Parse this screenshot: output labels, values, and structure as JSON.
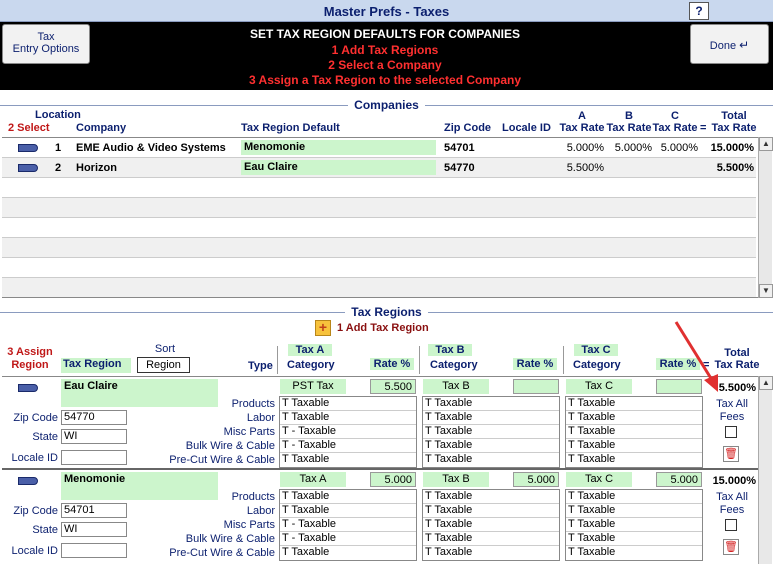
{
  "window": {
    "title": "Master Prefs - Taxes",
    "help": "?"
  },
  "toolbar": {
    "tax_entry_line1": "Tax",
    "tax_entry_line2": "Entry Options",
    "done_label": "Done",
    "heading": "SET TAX REGION DEFAULTS FOR COMPANIES",
    "step1": "1 Add Tax Regions",
    "step2": "2 Select a Company",
    "step3": "3 Assign a Tax Region to the selected Company"
  },
  "companies": {
    "section_title": "Companies",
    "headers": {
      "location": "Location",
      "select": "2 Select",
      "company": "Company",
      "tax_region_default": "Tax Region Default",
      "zip": "Zip Code",
      "locale": "Locale ID",
      "a_top": "A",
      "a_bottom": "Tax Rate",
      "b_top": "B",
      "b_bottom": "Tax Rate",
      "c_top": "C",
      "c_bottom": "Tax Rate",
      "eq": "=",
      "total_top": "Total",
      "total_bottom": "Tax Rate"
    },
    "rows": [
      {
        "num": "1",
        "company": "EME Audio & Video Systems",
        "region": "Menomonie",
        "zip": "54701",
        "locale": "",
        "a": "5.000%",
        "b": "5.000%",
        "c": "5.000%",
        "total": "15.000%"
      },
      {
        "num": "2",
        "company": "Horizon",
        "region": "Eau Claire",
        "zip": "54770",
        "locale": "",
        "a": "5.500%",
        "b": "",
        "c": "",
        "total": "5.500%"
      }
    ]
  },
  "regions": {
    "section_title": "Tax Regions",
    "add_label": "1 Add Tax Region",
    "headers": {
      "assign_top": "3 Assign",
      "assign_bottom": "Region",
      "tax_region": "Tax Region",
      "sort": "Sort",
      "sort_button": "Region",
      "type": "Type",
      "taxa_top": "Tax A",
      "taxa_bottom": "Category",
      "taxb_top": "Tax B",
      "taxb_bottom": "Category",
      "taxc_top": "Tax C",
      "taxc_bottom": "Category",
      "rate": "Rate %",
      "eq": "=",
      "total_top": "Total",
      "total_bottom": "Tax Rate"
    },
    "field_labels": {
      "zip": "Zip Code",
      "state": "State",
      "locale": "Locale ID",
      "tax_all_1": "Tax All",
      "tax_all_2": "Fees"
    },
    "types": [
      "Products",
      "Labor",
      "Misc Parts",
      "Bulk Wire & Cable",
      "Pre-Cut Wire & Cable"
    ],
    "items": [
      {
        "name": "Eau Claire",
        "zip": "54770",
        "state": "WI",
        "locale": "",
        "taxa_name": "PST Tax",
        "taxa_rate": "5.500",
        "taxb_name": "Tax B",
        "taxb_rate": "",
        "taxc_name": "Tax C",
        "taxc_rate": "",
        "total": "5.500%",
        "cat_a": [
          "T  Taxable",
          "T  Taxable",
          "T - Taxable",
          "T - Taxable",
          "T  Taxable"
        ],
        "cat_b": [
          "T  Taxable",
          "T  Taxable",
          "T  Taxable",
          "T  Taxable",
          "T  Taxable"
        ],
        "cat_c": [
          "T  Taxable",
          "T  Taxable",
          "T  Taxable",
          "T  Taxable",
          "T  Taxable"
        ]
      },
      {
        "name": "Menomonie",
        "zip": "54701",
        "state": "WI",
        "locale": "",
        "taxa_name": "Tax A",
        "taxa_rate": "5.000",
        "taxb_name": "Tax B",
        "taxb_rate": "5.000",
        "taxc_name": "Tax C",
        "taxc_rate": "5.000",
        "total": "15.000%",
        "cat_a": [
          "T  Taxable",
          "T  Taxable",
          "T - Taxable",
          "T - Taxable",
          "T  Taxable"
        ],
        "cat_b": [
          "T  Taxable",
          "T  Taxable",
          "T  Taxable",
          "T  Taxable",
          "T  Taxable"
        ],
        "cat_c": [
          "T  Taxable",
          "T  Taxable",
          "T  Taxable",
          "T  Taxable",
          "T  Taxable"
        ]
      }
    ]
  },
  "colors": {
    "accent_navy": "#0b1f6e",
    "instruction_red": "#d42020",
    "field_green": "#ccf5cc"
  }
}
